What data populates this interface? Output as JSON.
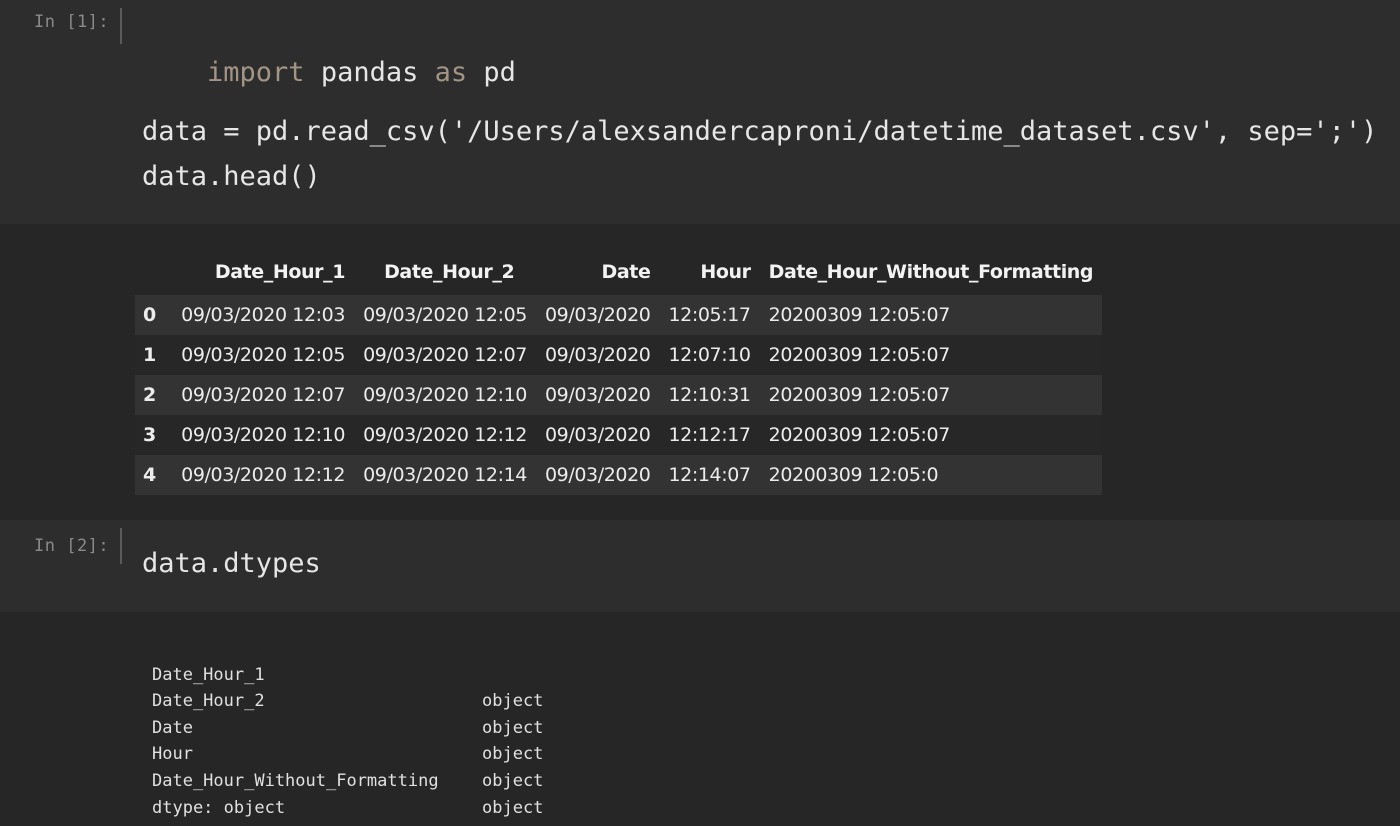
{
  "cells": [
    {
      "prompt": "In [1]:",
      "code": {
        "line1_kw1": "import",
        "line1_mod": " pandas ",
        "line1_kw2": "as",
        "line1_alias": " pd",
        "line2": "data = pd.read_csv('/Users/alexsandercaproni/datetime_dataset.csv', sep=';')",
        "line3": "data.head()"
      }
    },
    {
      "prompt": "In [2]:",
      "code": {
        "line1": "data.dtypes"
      }
    }
  ],
  "dataframe": {
    "columns": [
      "",
      "Date_Hour_1",
      "Date_Hour_2",
      "Date",
      "Hour",
      "Date_Hour_Without_Formatting"
    ],
    "rows": [
      {
        "index": "0",
        "cells": [
          "09/03/2020 12:03",
          "09/03/2020 12:05",
          "09/03/2020",
          "12:05:17",
          "20200309 12:05:07"
        ]
      },
      {
        "index": "1",
        "cells": [
          "09/03/2020 12:05",
          "09/03/2020 12:07",
          "09/03/2020",
          "12:07:10",
          "20200309 12:05:07"
        ]
      },
      {
        "index": "2",
        "cells": [
          "09/03/2020 12:07",
          "09/03/2020 12:10",
          "09/03/2020",
          "12:10:31",
          "20200309 12:05:07"
        ]
      },
      {
        "index": "3",
        "cells": [
          "09/03/2020 12:10",
          "09/03/2020 12:12",
          "09/03/2020",
          "12:12:17",
          "20200309 12:05:07"
        ]
      },
      {
        "index": "4",
        "cells": [
          "09/03/2020 12:12",
          "09/03/2020 12:14",
          "09/03/2020",
          "12:14:07",
          "20200309 12:05:0"
        ]
      }
    ]
  },
  "dtypes": {
    "rows": [
      {
        "name": "Date_Hour_1",
        "type": "object"
      },
      {
        "name": "Date_Hour_2",
        "type": "object"
      },
      {
        "name": "Date",
        "type": "object"
      },
      {
        "name": "Hour",
        "type": "object"
      },
      {
        "name": "Date_Hour_Without_Formatting",
        "type": "object"
      }
    ],
    "footer": "dtype: object"
  },
  "colors": {
    "background": "#222222",
    "cell_background": "#2d2d2d",
    "keyword": "#a39586",
    "prompt": "#8a8a8a"
  }
}
